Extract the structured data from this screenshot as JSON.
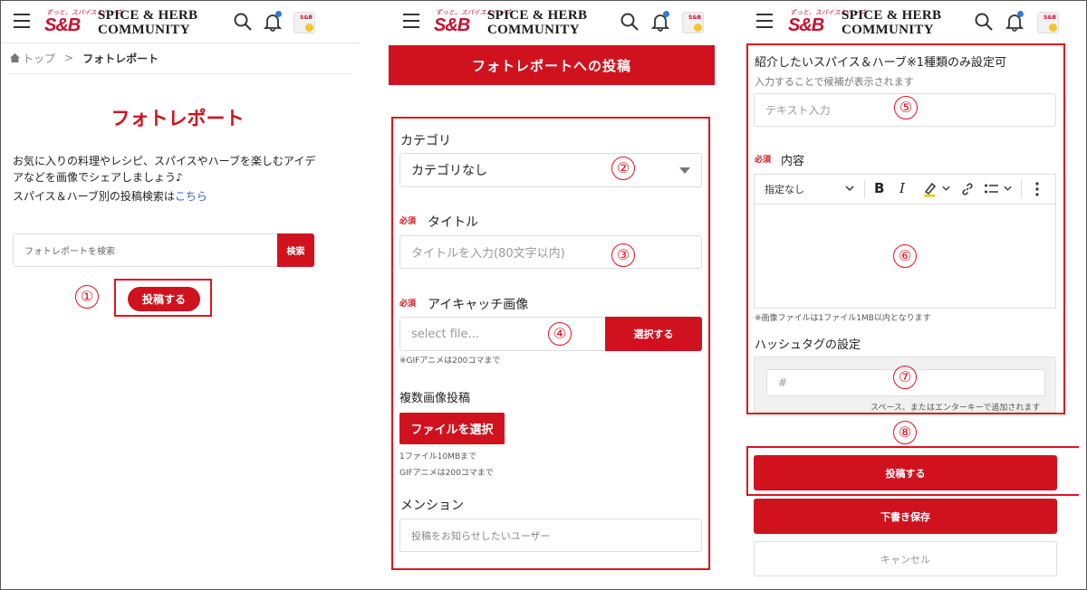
{
  "brand": {
    "tagline": "ずっと、スパイス＆ハーブ",
    "mark": "S&B",
    "line1": "SPICE & HERB",
    "line2": "COMMUNITY",
    "accent": "#d0121f",
    "annotation_color": "#e0141e"
  },
  "icons": {
    "menu": "hamburger-icon",
    "search": "search-icon",
    "notifications": "bell-icon",
    "user": "avatar"
  },
  "panel1": {
    "breadcrumb_home": "トップ",
    "breadcrumb_sep": ">",
    "breadcrumb_current": "フォトレポート",
    "title": "フォトレポート",
    "desc1": "お気に入りの料理やレシピ、スパイスやハーブを楽しむアイデ",
    "desc2": "アなどを画像でシェアしましょう♪",
    "desc3": "スパイス＆ハーブ別の投稿検索は",
    "desc3_link": "こちら",
    "search_placeholder": "フォトレポートを検索",
    "search_button": "検索",
    "post_button": "投稿する",
    "marker1": "①"
  },
  "panel2": {
    "banner": "フォトレポートへの投稿",
    "category_label": "カテゴリ",
    "category_value": "カテゴリなし",
    "required": "必須",
    "title_label": "タイトル",
    "title_placeholder": "タイトルを入力(80文字以内)",
    "eyecatch_label": "アイキャッチ画像",
    "file_placeholder": "select file...",
    "file_button": "選択する",
    "gif_note": "※GIFアニメは200コマまで",
    "multi_label": "複数画像投稿",
    "multi_button": "ファイルを選択",
    "multi_note1": "1ファイル10MBまで",
    "multi_note2": "GIFアニメは200コマまで",
    "mention_label": "メンション",
    "mention_placeholder": "投稿をお知らせしたいユーザー",
    "marker2": "②",
    "marker3": "③",
    "marker4": "④"
  },
  "panel3": {
    "spice_label": "紹介したいスパイス＆ハーブ※1種類のみ設定可",
    "spice_hint": "入力することで候補が表示されます",
    "spice_placeholder": "テキスト入力",
    "required": "必須",
    "content_label": "内容",
    "toolbar_style": "指定なし",
    "toolbar_bold": "B",
    "toolbar_italic": "I",
    "image_note": "※画像ファイルは1ファイル1MB以内となります",
    "hashtag_label": "ハッシュタグの設定",
    "hashtag_placeholder": "#",
    "hashtag_hint": "スペース、またはエンターキーで追加されます",
    "submit_button": "投稿する",
    "draft_button": "下書き保存",
    "cancel_button": "キャンセル",
    "marker5": "⑤",
    "marker6": "⑥",
    "marker7": "⑦",
    "marker8": "⑧"
  }
}
